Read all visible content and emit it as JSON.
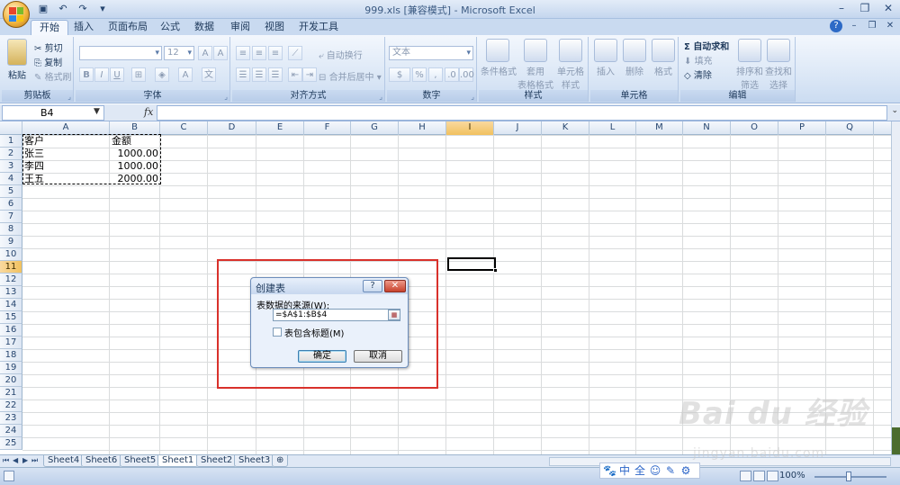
{
  "app": {
    "window_title": "999.xls [兼容模式] - Microsoft Excel",
    "qat": {
      "save": "save-icon",
      "undo": "↶",
      "redo": "↷"
    }
  },
  "ribbon": {
    "tabs": [
      "开始",
      "插入",
      "页面布局",
      "公式",
      "数据",
      "审阅",
      "视图",
      "开发工具"
    ],
    "active_tab": "开始",
    "clipboard": {
      "paste": "粘贴",
      "cut": "剪切",
      "copy": "复制",
      "format_painter": "格式刷",
      "label": "剪贴板"
    },
    "font": {
      "size": "12",
      "label": "字体",
      "bold": "B",
      "italic": "I",
      "underline": "U"
    },
    "alignment": {
      "wrap": "自动换行",
      "merge": "合并后居中",
      "label": "对齐方式"
    },
    "number": {
      "format": "文本",
      "percent": "%",
      "comma": ",",
      "label": "数字"
    },
    "styles": {
      "conditional": "条件格式",
      "table_format_1": "套用",
      "table_format_2": "表格格式",
      "cell_styles_1": "单元格",
      "cell_styles_2": "样式",
      "label": "样式"
    },
    "cells": {
      "insert": "插入",
      "delete": "删除",
      "format": "格式",
      "label": "单元格"
    },
    "editing": {
      "autosum": "Σ 自动求和",
      "fill": "填充",
      "clear": "清除",
      "sort_1": "排序和",
      "sort_2": "筛选",
      "find_1": "查找和",
      "find_2": "选择",
      "label": "编辑"
    }
  },
  "formula_bar": {
    "name_box": "B4",
    "fx": "fx",
    "value": ""
  },
  "sheet": {
    "columns": [
      "A",
      "B",
      "C",
      "D",
      "E",
      "F",
      "G",
      "H",
      "I",
      "J",
      "K",
      "L",
      "M",
      "N",
      "O",
      "P",
      "Q"
    ],
    "selected_column": "I",
    "rows": [
      "1",
      "2",
      "3",
      "4",
      "5",
      "6",
      "7",
      "8",
      "9",
      "10",
      "11",
      "12",
      "13",
      "14",
      "15",
      "16",
      "17",
      "18",
      "19",
      "20",
      "21",
      "22",
      "23",
      "24",
      "25"
    ],
    "selected_row": "11",
    "data": [
      [
        "客户",
        "金额"
      ],
      [
        "张三",
        "1000.00"
      ],
      [
        "李四",
        "1000.00"
      ],
      [
        "王五",
        "2000.00"
      ]
    ]
  },
  "sheet_tabs": {
    "tabs": [
      "Sheet4",
      "Sheet6",
      "Sheet5",
      "Sheet1",
      "Sheet2",
      "Sheet3"
    ],
    "active": "Sheet1"
  },
  "status": {
    "zoom": "100%"
  },
  "dialog": {
    "title": "创建表",
    "help": "?",
    "close": "✕",
    "source_label": "表数据的来源(W):",
    "range": "=$A$1:$B$4",
    "has_headers_label": "表包含标题(M)",
    "has_headers_checked": false,
    "ok": "确定",
    "cancel": "取消"
  },
  "ime": [
    "🐾",
    "中",
    "全",
    "☺",
    "✎",
    "⚙"
  ],
  "watermark": {
    "main": "Bai du 经验",
    "sub": "jingyan.baidu.com"
  }
}
